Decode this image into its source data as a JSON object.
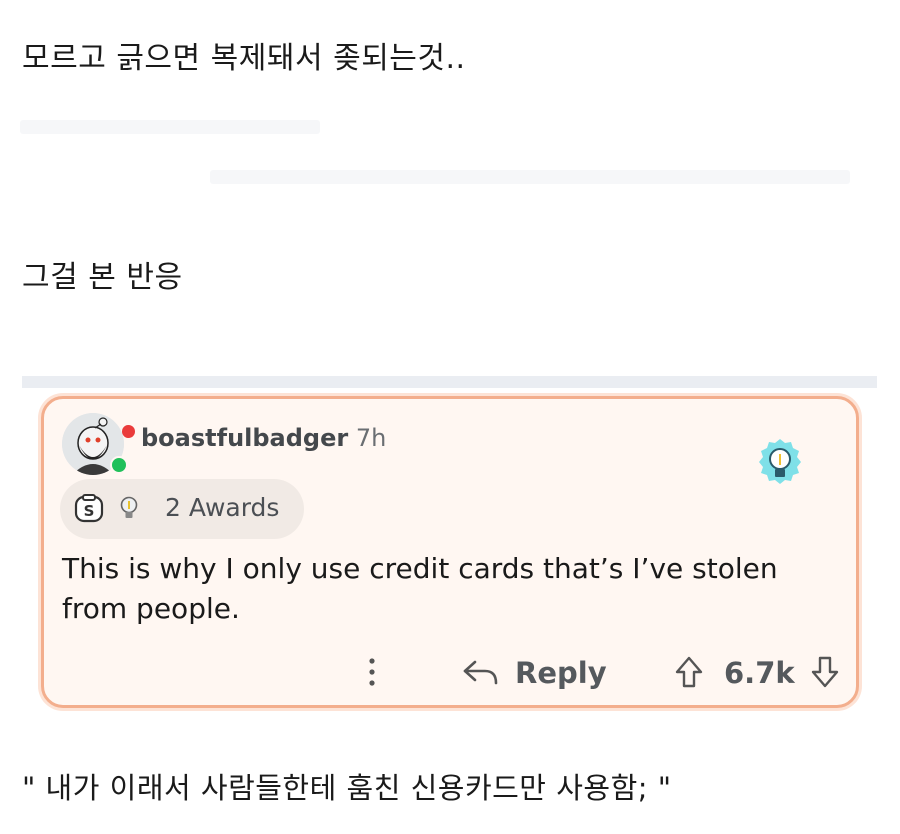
{
  "post": {
    "line1": "모르고 긁으면 복제돼서 좆되는것..",
    "line2": "그걸 본 반응",
    "line3": "\" 내가 이래서 사람들한테 훔친 신용카드만 사용함;  \""
  },
  "comment": {
    "username": "boastfulbadger",
    "age": "7h",
    "awards_label": "2 Awards",
    "text": "This is why I only use credit cards that’s I’ve stolen from people.",
    "reply_label": "Reply",
    "vote_count": "6.7k"
  },
  "colors": {
    "card_border": "#f3ae8d",
    "card_bg": "#fff7f2",
    "online": "#20c05a",
    "notification": "#ea3b3b",
    "bulb": "#7fe0e8"
  },
  "icons": [
    "avatar",
    "online-dot",
    "notification-dot",
    "lightbulb-award-icon",
    "coin-award-icon",
    "more-options-icon",
    "reply-icon",
    "upvote-icon",
    "downvote-icon"
  ]
}
